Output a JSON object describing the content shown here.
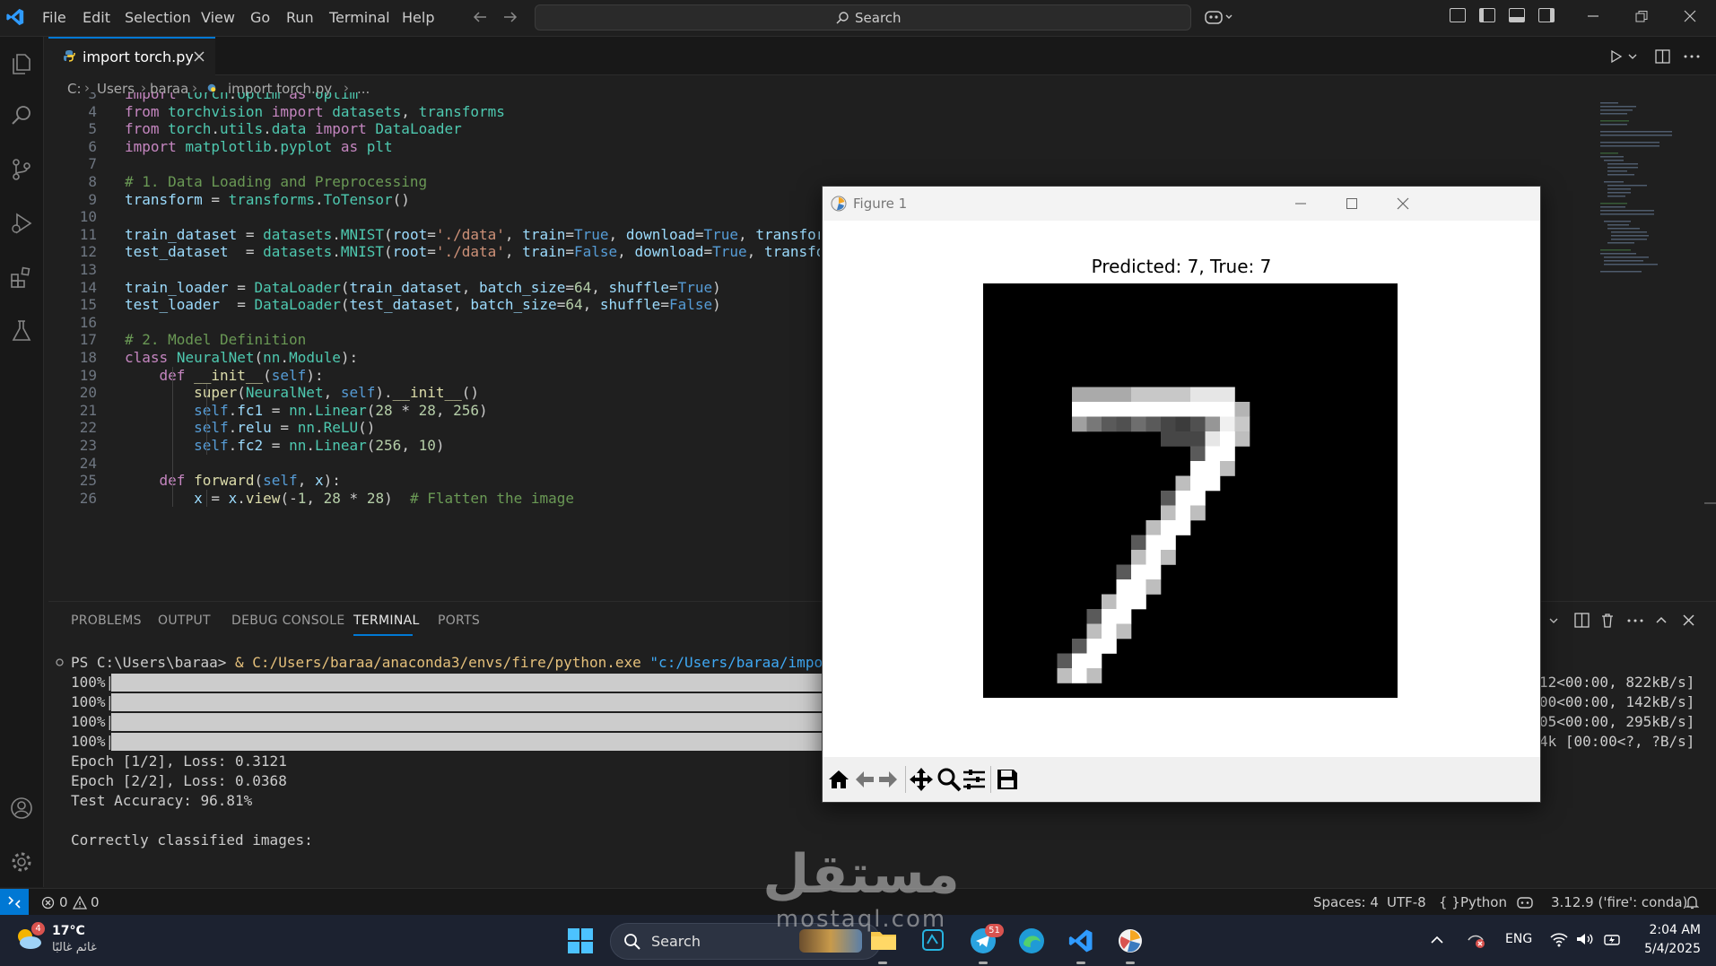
{
  "app": {
    "menu": [
      "File",
      "Edit",
      "Selection",
      "View",
      "Go",
      "Run",
      "Terminal",
      "Help"
    ],
    "search_placeholder": "Search"
  },
  "editor": {
    "tab_label": "import torch.py",
    "breadcrumb": [
      "C:",
      "Users",
      "baraa",
      "import torch.py",
      "..."
    ],
    "lines": [
      {
        "n": "3",
        "text": "import torch.optim as optim"
      },
      {
        "n": "4",
        "text": "from torchvision import datasets, transforms"
      },
      {
        "n": "5",
        "text": "from torch.utils.data import DataLoader"
      },
      {
        "n": "6",
        "text": "import matplotlib.pyplot as plt"
      },
      {
        "n": "7",
        "text": ""
      },
      {
        "n": "8",
        "text": "# 1. Data Loading and Preprocessing"
      },
      {
        "n": "9",
        "text": "transform = transforms.ToTensor()"
      },
      {
        "n": "10",
        "text": ""
      },
      {
        "n": "11",
        "text": "train_dataset = datasets.MNIST(root='./data', train=True, download=True, transfor"
      },
      {
        "n": "12",
        "text": "test_dataset  = datasets.MNIST(root='./data', train=False, download=True, transfo"
      },
      {
        "n": "13",
        "text": ""
      },
      {
        "n": "14",
        "text": "train_loader = DataLoader(train_dataset, batch_size=64, shuffle=True)"
      },
      {
        "n": "15",
        "text": "test_loader  = DataLoader(test_dataset, batch_size=64, shuffle=False)"
      },
      {
        "n": "16",
        "text": ""
      },
      {
        "n": "17",
        "text": "# 2. Model Definition"
      },
      {
        "n": "18",
        "text": "class NeuralNet(nn.Module):"
      },
      {
        "n": "19",
        "text": "    def __init__(self):"
      },
      {
        "n": "20",
        "text": "        super(NeuralNet, self).__init__()"
      },
      {
        "n": "21",
        "text": "        self.fc1 = nn.Linear(28 * 28, 256)"
      },
      {
        "n": "22",
        "text": "        self.relu = nn.ReLU()"
      },
      {
        "n": "23",
        "text": "        self.fc2 = nn.Linear(256, 10)"
      },
      {
        "n": "24",
        "text": ""
      },
      {
        "n": "25",
        "text": "    def forward(self, x):"
      },
      {
        "n": "26",
        "text": "        x = x.view(-1, 28 * 28)  # Flatten the image"
      }
    ]
  },
  "panel": {
    "tabs": [
      "PROBLEMS",
      "OUTPUT",
      "DEBUG CONSOLE",
      "TERMINAL",
      "PORTS"
    ],
    "active_tab": "TERMINAL",
    "terminal": {
      "prompt": "PS C:\\Users\\baraa> ",
      "command_amp": "& ",
      "command_exe": "C:/Users/baraa/anaconda3/envs/fire/python.exe",
      "command_arg": "\"c:/Users/baraa/import tor",
      "progress": [
        {
          "label": "100%|",
          "right": "12<00:00, 822kB/s]"
        },
        {
          "label": "100%|",
          "right": "00<00:00, 142kB/s]"
        },
        {
          "label": "100%|",
          "right": "05<00:00, 295kB/s]"
        },
        {
          "label": "100%|",
          "right": "4k [00:00<?, ?B/s]"
        }
      ],
      "output": [
        "Epoch [1/2], Loss: 0.3121",
        "Epoch [2/2], Loss: 0.0368",
        "Test Accuracy: 96.81%",
        "",
        "Correctly classified images:"
      ]
    }
  },
  "figure": {
    "window_title": "Figure 1",
    "plot_title": "Predicted: 7, True: 7"
  },
  "statusbar": {
    "errors": "0",
    "warnings": "0",
    "spaces": "Spaces: 4",
    "encoding": "UTF-8",
    "language": "Python",
    "interpreter": "3.12.9 ('fire': conda)"
  },
  "taskbar": {
    "weather_temp": "17°C",
    "weather_desc": "غائم غالبًا",
    "weather_badge": "4",
    "search_label": "Search",
    "telegram_badge": "51",
    "language": "ENG",
    "time": "2:04 AM",
    "date": "5/4/2025"
  },
  "watermark": {
    "arabic": "مستقل",
    "latin": "mostaql.com"
  },
  "colors": {
    "accent": "#0078d4",
    "editor_bg": "#1f1f1f",
    "keyword": "#c586c0",
    "comment": "#6a9955"
  }
}
